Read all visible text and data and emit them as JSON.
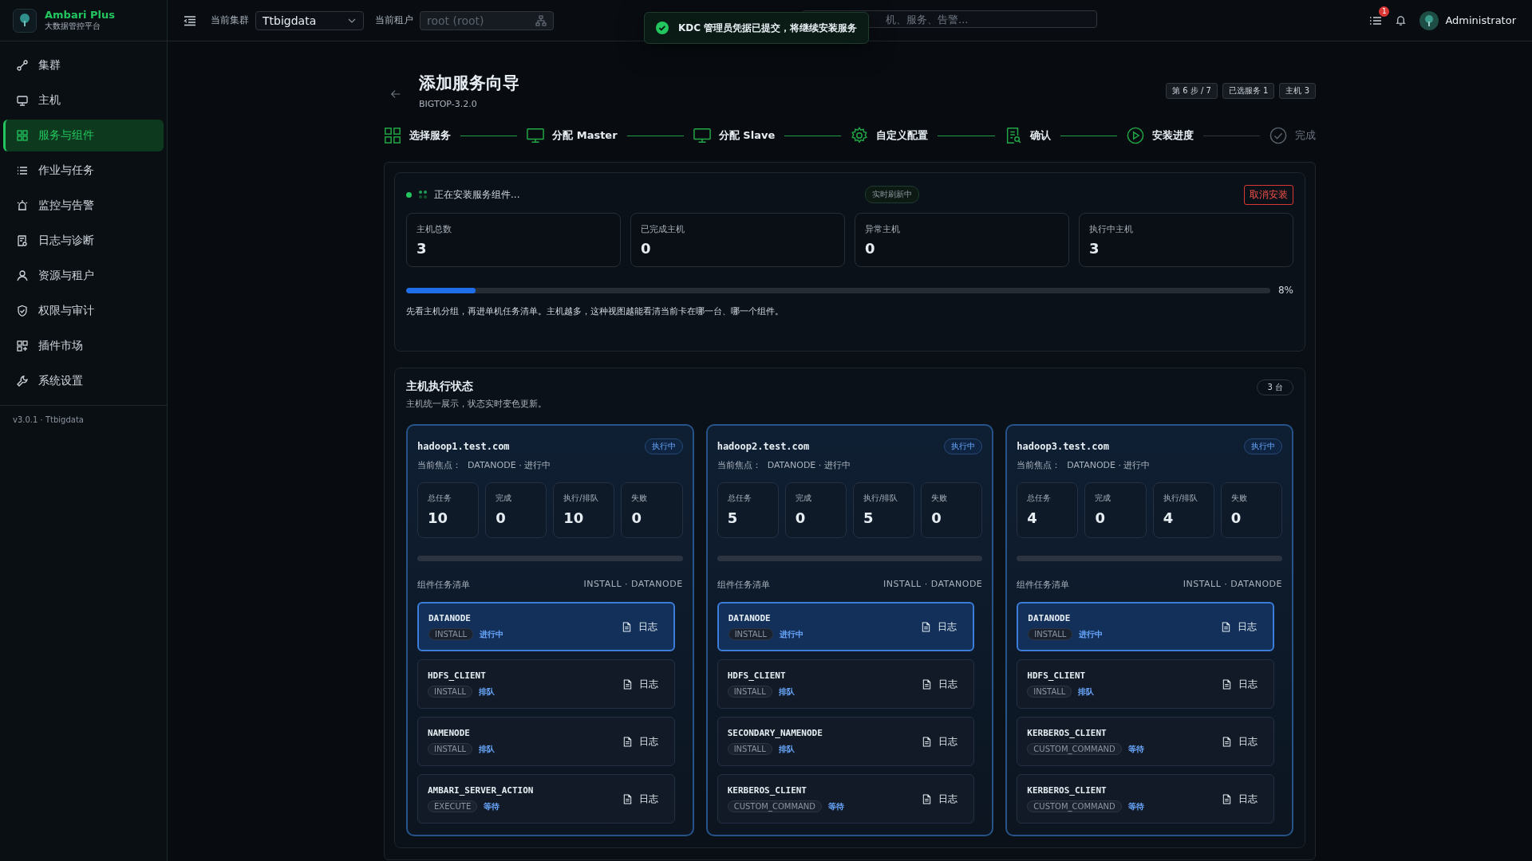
{
  "app": {
    "name": "Ambari Plus",
    "subtitle": "大数据管控平台"
  },
  "sidebar": {
    "items": [
      {
        "label": "集群",
        "selected": false
      },
      {
        "label": "主机",
        "selected": false
      },
      {
        "label": "服务与组件",
        "selected": true
      },
      {
        "label": "作业与任务",
        "selected": false
      },
      {
        "label": "监控与告警",
        "selected": false
      },
      {
        "label": "日志与诊断",
        "selected": false
      },
      {
        "label": "资源与租户",
        "selected": false
      },
      {
        "label": "权限与审计",
        "selected": false
      },
      {
        "label": "插件市场",
        "selected": false
      },
      {
        "label": "系统设置",
        "selected": false
      }
    ],
    "version": "v3.0.1 · Ttbigdata"
  },
  "header": {
    "cluster_label": "当前集群",
    "cluster": "Ttbigdata",
    "tenant_label": "当前租户",
    "tenant": "root (root)",
    "search_placeholder": "机、服务、告警...",
    "notification_count": "1",
    "user": "Administrator"
  },
  "toast": {
    "message": "KDC 管理员凭据已提交，将继续安装服务"
  },
  "wizard": {
    "title": "添加服务向导",
    "subtitle": "BIGTOP-3.2.0",
    "badges": [
      "第 6 步 / 7",
      "已选服务 1",
      "主机 3"
    ],
    "steps": [
      {
        "label": "选择服务",
        "reached": true
      },
      {
        "label": "分配 Master",
        "reached": true
      },
      {
        "label": "分配 Slave",
        "reached": true
      },
      {
        "label": "自定义配置",
        "reached": true
      },
      {
        "label": "确认",
        "reached": true
      },
      {
        "label": "安装进度",
        "reached": true
      },
      {
        "label": "完成",
        "reached": false
      }
    ]
  },
  "install": {
    "status": "正在安装服务组件...",
    "live_tag": "实时刷新中",
    "cancel": "取消安装",
    "stats": [
      {
        "label": "主机总数",
        "value": "3"
      },
      {
        "label": "已完成主机",
        "value": "0"
      },
      {
        "label": "异常主机",
        "value": "0"
      },
      {
        "label": "执行中主机",
        "value": "3"
      }
    ],
    "progress": {
      "level": 0.08,
      "reading": "8%"
    },
    "note": "先看主机分组，再进单机任务清单。主机越多，这种视图越能看清当前卡在哪一台、哪一个组件。"
  },
  "hosts": {
    "title": "主机执行状态",
    "subtitle": "主机统一展示，状态实时变色更新。",
    "count": "3 台",
    "cards": [
      {
        "name": "hadoop1.test.com",
        "status": "执行中",
        "focus_label": "当前焦点：",
        "focus": "DATANODE · 进行中",
        "stats": [
          {
            "label": "总任务",
            "value": "10"
          },
          {
            "label": "完成",
            "value": "0"
          },
          {
            "label": "执行/排队",
            "value": "10"
          },
          {
            "label": "失败",
            "value": "0"
          }
        ],
        "level": 0,
        "list_title": "组件任务清单",
        "list_meta": "INSTALL · DATANODE",
        "tasks": [
          {
            "name": "DATANODE",
            "command": "INSTALL",
            "state": "进行中",
            "log": "日志",
            "selected": true
          },
          {
            "name": "HDFS_CLIENT",
            "command": "INSTALL",
            "state": "排队",
            "log": "日志",
            "selected": false
          },
          {
            "name": "NAMENODE",
            "command": "INSTALL",
            "state": "排队",
            "log": "日志",
            "selected": false
          },
          {
            "name": "AMBARI_SERVER_ACTION",
            "command": "EXECUTE",
            "state": "等待",
            "log": "日志",
            "selected": false
          }
        ]
      },
      {
        "name": "hadoop2.test.com",
        "status": "执行中",
        "focus_label": "当前焦点：",
        "focus": "DATANODE · 进行中",
        "stats": [
          {
            "label": "总任务",
            "value": "5"
          },
          {
            "label": "完成",
            "value": "0"
          },
          {
            "label": "执行/排队",
            "value": "5"
          },
          {
            "label": "失败",
            "value": "0"
          }
        ],
        "level": 0,
        "list_title": "组件任务清单",
        "list_meta": "INSTALL · DATANODE",
        "tasks": [
          {
            "name": "DATANODE",
            "command": "INSTALL",
            "state": "进行中",
            "log": "日志",
            "selected": true
          },
          {
            "name": "HDFS_CLIENT",
            "command": "INSTALL",
            "state": "排队",
            "log": "日志",
            "selected": false
          },
          {
            "name": "SECONDARY_NAMENODE",
            "command": "INSTALL",
            "state": "排队",
            "log": "日志",
            "selected": false
          },
          {
            "name": "KERBEROS_CLIENT",
            "command": "CUSTOM_COMMAND",
            "state": "等待",
            "log": "日志",
            "selected": false
          }
        ]
      },
      {
        "name": "hadoop3.test.com",
        "status": "执行中",
        "focus_label": "当前焦点：",
        "focus": "DATANODE · 进行中",
        "stats": [
          {
            "label": "总任务",
            "value": "4"
          },
          {
            "label": "完成",
            "value": "0"
          },
          {
            "label": "执行/排队",
            "value": "4"
          },
          {
            "label": "失败",
            "value": "0"
          }
        ],
        "level": 0,
        "list_title": "组件任务清单",
        "list_meta": "INSTALL · DATANODE",
        "tasks": [
          {
            "name": "DATANODE",
            "command": "INSTALL",
            "state": "进行中",
            "log": "日志",
            "selected": true
          },
          {
            "name": "HDFS_CLIENT",
            "command": "INSTALL",
            "state": "排队",
            "log": "日志",
            "selected": false
          },
          {
            "name": "KERBEROS_CLIENT",
            "command": "CUSTOM_COMMAND",
            "state": "等待",
            "log": "日志",
            "selected": false
          },
          {
            "name": "KERBEROS_CLIENT",
            "command": "CUSTOM_COMMAND",
            "state": "等待",
            "log": "日志",
            "selected": false
          }
        ]
      }
    ]
  }
}
